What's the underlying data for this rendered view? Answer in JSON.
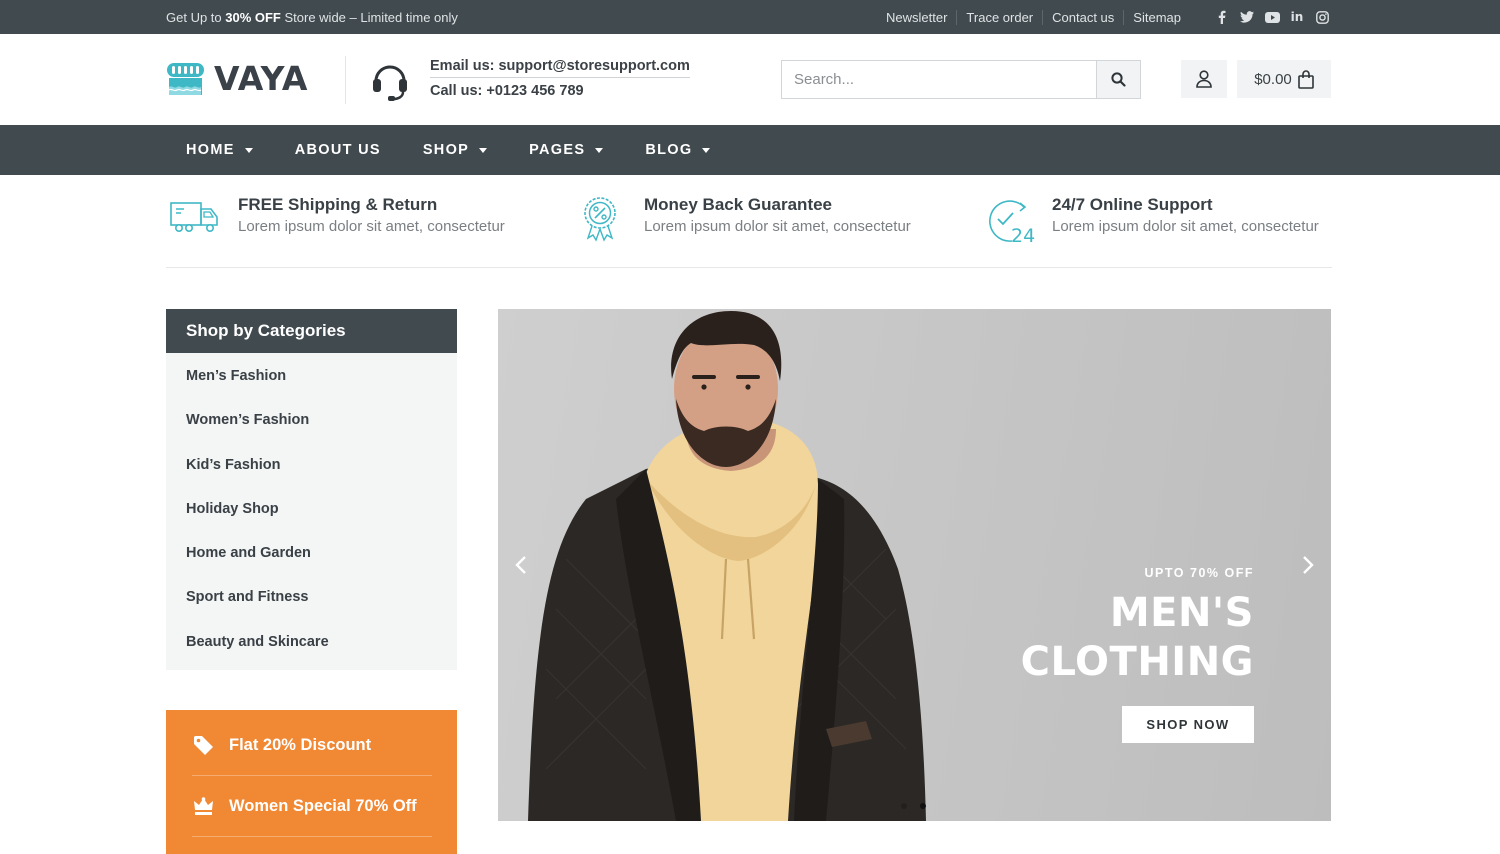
{
  "topbar": {
    "promo_prefix": "Get Up to ",
    "promo_bold": "30% OFF",
    "promo_suffix": " Store wide – Limited time only",
    "links": [
      "Newsletter",
      "Trace order",
      "Contact us",
      "Sitemap"
    ],
    "social_icons": [
      "facebook-icon",
      "twitter-icon",
      "youtube-icon",
      "linkedin-icon",
      "instagram-icon"
    ],
    "social_glyphs": [
      "f",
      "t",
      "▶",
      "in",
      "◎"
    ]
  },
  "header": {
    "brand": "VAYA",
    "email": "Email us: support@storesupport.com",
    "phone": "Call us: +0123 456 789",
    "search_placeholder": "Search...",
    "cart_total": "$0.00"
  },
  "nav": {
    "items": [
      {
        "label": "HOME",
        "dropdown": true
      },
      {
        "label": "ABOUT US",
        "dropdown": false
      },
      {
        "label": "SHOP",
        "dropdown": true
      },
      {
        "label": "PAGES",
        "dropdown": true
      },
      {
        "label": "BLOG",
        "dropdown": true
      }
    ]
  },
  "features": [
    {
      "icon": "truck-icon",
      "title": "FREE Shipping & Return",
      "subtitle": "Lorem ipsum dolor sit amet, consectetur"
    },
    {
      "icon": "badge-percent-icon",
      "title": "Money Back Guarantee",
      "subtitle": "Lorem ipsum dolor sit amet, consectetur"
    },
    {
      "icon": "support-24-icon",
      "title": "24/7 Online Support",
      "subtitle": "Lorem ipsum dolor sit amet, consectetur"
    }
  ],
  "categories": {
    "title": "Shop by Categories",
    "items": [
      "Men’s Fashion",
      "Women’s Fashion",
      "Kid’s Fashion",
      "Holiday Shop",
      "Home and Garden",
      "Sport and Fitness",
      "Beauty and Skincare"
    ]
  },
  "promos": [
    {
      "icon": "tag-icon",
      "label": "Flat 20% Discount"
    },
    {
      "icon": "crown-icon",
      "label": "Women Special 70% Off"
    }
  ],
  "hero": {
    "kicker": "UPTO 70% OFF",
    "headline_line1": "MEN'S",
    "headline_line2": "CLOTHING",
    "button": "SHOP NOW",
    "active_slide": 2,
    "slide_count": 2
  },
  "colors": {
    "dark_bar": "#414a4f",
    "accent_teal": "#3fb8c6",
    "promo_orange": "#f08834"
  }
}
